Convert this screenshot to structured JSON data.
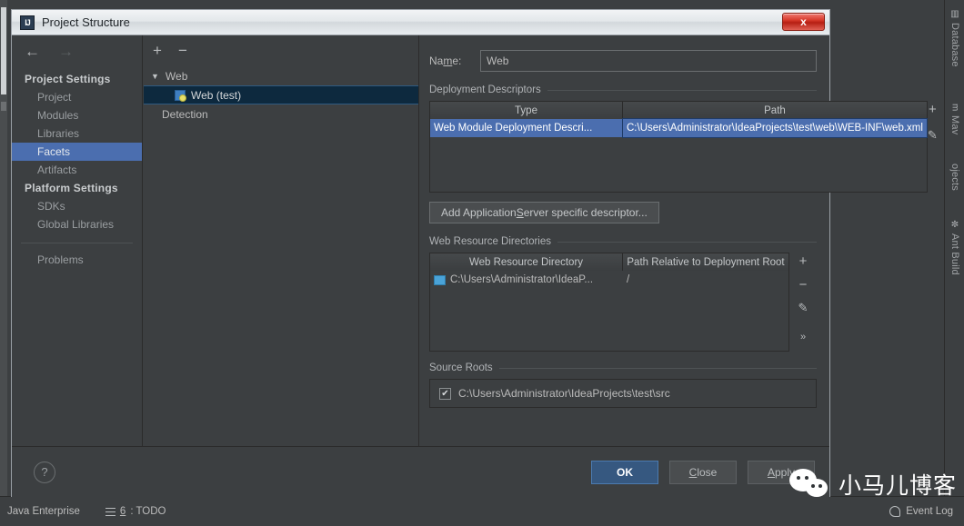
{
  "window": {
    "title": "Project Structure",
    "app_icon": "IJ",
    "close_label": "x"
  },
  "left_pane": {
    "back_icon": "←",
    "forward_icon": "→",
    "groups": [
      {
        "label": "Project Settings",
        "items": [
          {
            "label": "Project",
            "selected": false
          },
          {
            "label": "Modules",
            "selected": false
          },
          {
            "label": "Libraries",
            "selected": false
          },
          {
            "label": "Facets",
            "selected": true
          },
          {
            "label": "Artifacts",
            "selected": false
          }
        ]
      },
      {
        "label": "Platform Settings",
        "items": [
          {
            "label": "SDKs",
            "selected": false
          },
          {
            "label": "Global Libraries",
            "selected": false
          }
        ]
      }
    ],
    "extra_item": "Problems"
  },
  "mid_pane": {
    "add_icon": "+",
    "remove_icon": "−",
    "tree": {
      "root_caret": "▼",
      "root_label": "Web",
      "child_label": "Web (test)",
      "leaf_label": "Detection"
    }
  },
  "right_pane": {
    "name_label": "Na_m_e:",
    "name_label_pre": "Na",
    "name_label_underlined": "m",
    "name_label_post": "e:",
    "name_value": "Web",
    "deployment": {
      "title": "Deployment Descriptors",
      "columns": [
        "Type",
        "Path"
      ],
      "rows": [
        {
          "type": "Web Module Deployment Descri...",
          "path": "C:\\Users\\Administrator\\IdeaProjects\\test\\web\\WEB-INF\\web.xml"
        }
      ],
      "buttons": [
        "+",
        "✎"
      ]
    },
    "add_descriptor_button": {
      "pre": "Add Application ",
      "underlined": "S",
      "post": "erver specific descriptor..."
    },
    "web_resources": {
      "title": "Web Resource Directories",
      "columns": [
        "Web Resource Directory",
        "Path Relative to Deployment Root"
      ],
      "rows": [
        {
          "directory": "C:\\Users\\Administrator\\IdeaP...",
          "relative": "/"
        }
      ],
      "buttons": [
        "+",
        "−",
        "✎",
        "»"
      ]
    },
    "source_roots": {
      "title": "Source Roots",
      "rows": [
        {
          "checked": true,
          "check_glyph": "✔",
          "path": "C:\\Users\\Administrator\\IdeaProjects\\test\\src"
        }
      ]
    }
  },
  "footer": {
    "help_icon": "?",
    "buttons": [
      {
        "label": "OK",
        "primary": true,
        "underline": ""
      },
      {
        "label": "Close",
        "primary": false,
        "underline": "C"
      },
      {
        "label": "Apply",
        "primary": false,
        "underline": "A"
      }
    ]
  },
  "ide": {
    "right_tabs": [
      {
        "label": "Database",
        "icon": "▥"
      },
      {
        "label": "Mav",
        "icon": "m"
      },
      {
        "label": "ojects",
        "icon": ""
      },
      {
        "label": "Ant Build",
        "icon": "✼"
      }
    ],
    "statusbar": {
      "java_enterprise": "Java Enterprise",
      "todo_num": "6",
      "todo_label": ": TODO",
      "event_log": "Event Log"
    }
  },
  "watermark": {
    "text": "小马儿博客"
  },
  "colors": {
    "accent_selection": "#4b6eaf",
    "primary_button": "#365880",
    "tree_selection": "#0d293e",
    "background": "#3c3f41",
    "close_button": "#d73a2b"
  }
}
